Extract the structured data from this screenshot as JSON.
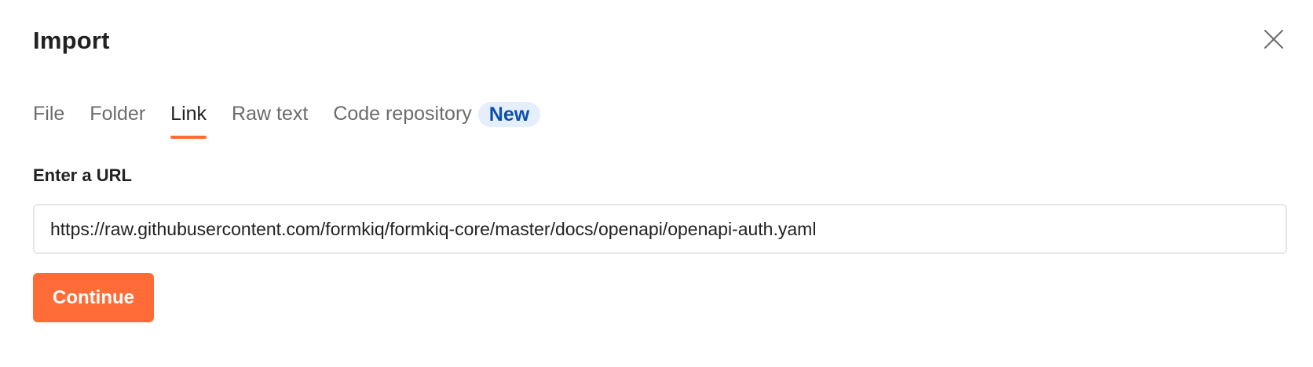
{
  "dialog": {
    "title": "Import",
    "close_icon": "close-icon"
  },
  "tabs": [
    {
      "label": "File",
      "active": false
    },
    {
      "label": "Folder",
      "active": false
    },
    {
      "label": "Link",
      "active": true
    },
    {
      "label": "Raw text",
      "active": false
    },
    {
      "label": "Code repository",
      "active": false,
      "badge": "New"
    }
  ],
  "url_field": {
    "label": "Enter a URL",
    "value": "https://raw.githubusercontent.com/formkiq/formkiq-core/master/docs/openapi/openapi-auth.yaml"
  },
  "actions": {
    "continue_label": "Continue"
  },
  "colors": {
    "accent": "#ff6c37",
    "badge_bg": "#e5eefb",
    "badge_text": "#0b4fae",
    "text": "#212121",
    "muted_text": "#6b6b6b",
    "input_border": "#e6e6e6"
  }
}
